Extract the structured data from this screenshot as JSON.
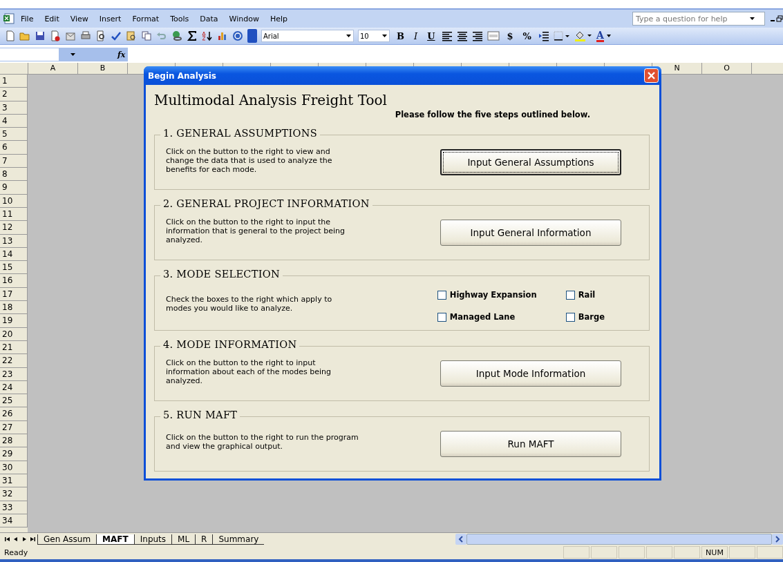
{
  "menu_bar": {
    "items": [
      "File",
      "Edit",
      "View",
      "Insert",
      "Format",
      "Tools",
      "Data",
      "Window",
      "Help"
    ],
    "help_placeholder": "Type a question for help"
  },
  "toolbar": {
    "font": "Arial",
    "size": "10",
    "text_buttons": [
      {
        "kind": "bold",
        "label": "B"
      },
      {
        "kind": "italic",
        "label": "I"
      },
      {
        "kind": "underline",
        "label": "U"
      }
    ],
    "number_buttons": [
      "$",
      "%"
    ],
    "font_color_label": "A"
  },
  "formula_bar": {
    "fx": "fx"
  },
  "sheet": {
    "left_columns": [
      "A",
      "B"
    ],
    "right_columns": [
      "N",
      "O"
    ],
    "rows": [
      "1",
      "2",
      "3",
      "4",
      "5",
      "6",
      "7",
      "8",
      "9",
      "10",
      "11",
      "12",
      "13",
      "14",
      "15",
      "16",
      "17",
      "18",
      "19",
      "20",
      "21",
      "22",
      "23",
      "24",
      "25",
      "26",
      "27",
      "28",
      "29",
      "30",
      "31",
      "32",
      "33",
      "34"
    ]
  },
  "dialog": {
    "title": "Begin Analysis",
    "heading": "Multimodal Analysis Freight Tool",
    "subtitle": "Please follow the five steps outlined below.",
    "sections": [
      {
        "kind": "button",
        "title": "1. GENERAL ASSUMPTIONS",
        "text": "Click on the button to the right to view and change the data that is used to analyze the benefits for each mode.",
        "button": "Input General Assumptions",
        "focused": true
      },
      {
        "kind": "button",
        "title": "2. GENERAL PROJECT INFORMATION",
        "text": "Click on the button to the right to input the information that is general to the project being analyzed.",
        "button": "Input General Information",
        "focused": false
      },
      {
        "kind": "checkboxes",
        "title": "3. MODE SELECTION",
        "text": "Check the boxes to the right which apply to modes you would like to analyze.",
        "options": [
          {
            "label": "Highway Expansion",
            "checked": false
          },
          {
            "label": "Rail",
            "checked": false
          },
          {
            "label": "Managed Lane",
            "checked": false
          },
          {
            "label": "Barge",
            "checked": false
          }
        ]
      },
      {
        "kind": "button",
        "title": "4. MODE INFORMATION",
        "text": "Click on the button to the right to input information about each of the modes being analyzed.",
        "button": "Input Mode Information",
        "focused": false
      },
      {
        "kind": "button",
        "title": "5. RUN MAFT",
        "text": "Click on the button to the right to run the program and view the graphical output.",
        "button": "Run MAFT",
        "focused": false
      }
    ]
  },
  "sheet_tabs": [
    {
      "label": "Gen Assum",
      "selected": false
    },
    {
      "label": "MAFT",
      "selected": true
    },
    {
      "label": "Inputs",
      "selected": false
    },
    {
      "label": "ML",
      "selected": false
    },
    {
      "label": "R",
      "selected": false
    },
    {
      "label": "Summary",
      "selected": false
    }
  ],
  "status_bar": {
    "status": "Ready",
    "num": "NUM"
  }
}
